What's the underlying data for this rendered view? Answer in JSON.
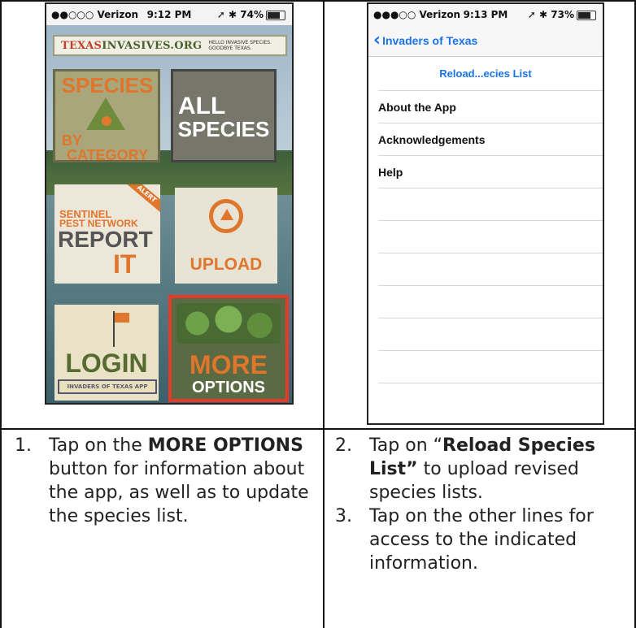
{
  "left_phone": {
    "status": {
      "carrier": "●●○○○ Verizon",
      "time": "9:12 PM",
      "battery": "74%"
    },
    "banner": {
      "logo_a": "TEXAS",
      "logo_b": "INVASIVES.ORG",
      "tagline": "HELLO INVASIVE SPECIES.\nGOODBYE TEXAS."
    },
    "tiles": {
      "species_by_category": {
        "line1": "SPECIES",
        "line2": "BY",
        "line3": "CATEGORY"
      },
      "all_species": {
        "line1": "ALL",
        "line2": "SPECIES"
      },
      "report_it": {
        "alert": "ALERT",
        "line1": "SENTINEL",
        "line2": "PEST NETWORK",
        "line3": "REPORT",
        "line4": "IT"
      },
      "upload": {
        "label": "UPLOAD"
      },
      "login": {
        "label": "LOGIN",
        "strip": "INVADERS OF TEXAS APP"
      },
      "more_options": {
        "line1": "MORE",
        "line2": "OPTIONS"
      }
    }
  },
  "right_phone": {
    "status": {
      "carrier": "●●●○○ Verizon",
      "time": "9:13 PM",
      "battery": "73%"
    },
    "nav": {
      "back_label": "Invaders of Texas"
    },
    "reload_label": "Reload...ecies List",
    "menu_items": [
      "About the App",
      "Acknowledgements",
      "Help"
    ]
  },
  "captions": {
    "step1": {
      "num": "1.",
      "pre": "Tap on the ",
      "bold": "MORE OPTIONS",
      "post": " button for information about the app, as well as to update the species list."
    },
    "step2": {
      "num": "2.",
      "pre": "Tap on “",
      "bold": "Reload Species List”",
      "post": " to upload revised species lists."
    },
    "step3": {
      "num": "3.",
      "text": "Tap on the other lines for access to the indicated information."
    }
  },
  "colors": {
    "accent_orange": "#e0752c",
    "highlight_red": "#e53a2a",
    "ios_blue": "#1a73e8"
  }
}
